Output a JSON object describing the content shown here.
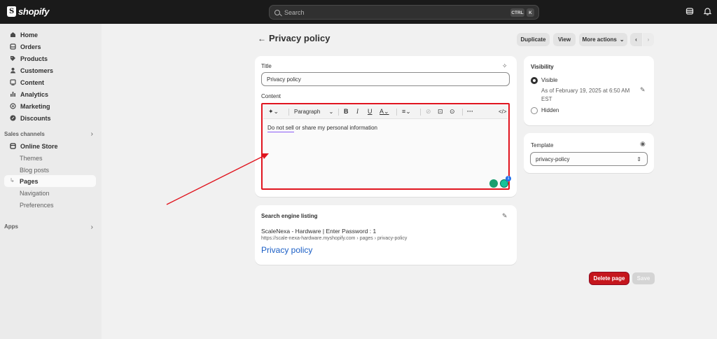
{
  "app": {
    "logo_text": "shopify"
  },
  "search": {
    "placeholder": "Search",
    "shortcut_ctrl": "CTRL",
    "shortcut_key": "K"
  },
  "sidebar": {
    "items": [
      {
        "label": "Home",
        "icon": "home-icon"
      },
      {
        "label": "Orders",
        "icon": "orders-icon"
      },
      {
        "label": "Products",
        "icon": "tag-icon"
      },
      {
        "label": "Customers",
        "icon": "person-icon"
      },
      {
        "label": "Content",
        "icon": "content-icon"
      },
      {
        "label": "Analytics",
        "icon": "bar-chart-icon"
      },
      {
        "label": "Marketing",
        "icon": "target-icon"
      },
      {
        "label": "Discounts",
        "icon": "discount-icon"
      }
    ],
    "sales_channels_label": "Sales channels",
    "online_store_label": "Online Store",
    "sub_items": [
      "Themes",
      "Blog posts",
      "Pages",
      "Navigation",
      "Preferences"
    ],
    "active_sub": "Pages",
    "apps_label": "Apps"
  },
  "header": {
    "title": "Privacy policy",
    "duplicate_label": "Duplicate",
    "view_label": "View",
    "more_actions_label": "More actions"
  },
  "main_card": {
    "title_label": "Title",
    "title_value": "Privacy policy",
    "content_label": "Content",
    "paragraph_select": "Paragraph",
    "editor_text_underlined": "Do not sell",
    "editor_text_rest": " or share my personal information",
    "grammarly_count": "1"
  },
  "seo_card": {
    "heading": "Search engine listing",
    "store_title": "ScaleNexa - Hardware | Enter Password : 1",
    "url": "https://scale-nexa-hardware.myshopify.com › pages › privacy-policy",
    "page_link": "Privacy policy"
  },
  "visibility_card": {
    "heading": "Visibility",
    "visible_label": "Visible",
    "visible_detail": "As of February 19, 2025 at 6:50 AM EST",
    "hidden_label": "Hidden",
    "selected": "Visible"
  },
  "template_card": {
    "heading": "Template",
    "selected": "privacy-policy"
  },
  "footer": {
    "delete_label": "Delete page",
    "save_label": "Save"
  },
  "colors": {
    "topbar": "#1a1a1a",
    "delete": "#c5161d",
    "annotation_red": "#e0151f",
    "link_blue": "#1a5ec5"
  }
}
